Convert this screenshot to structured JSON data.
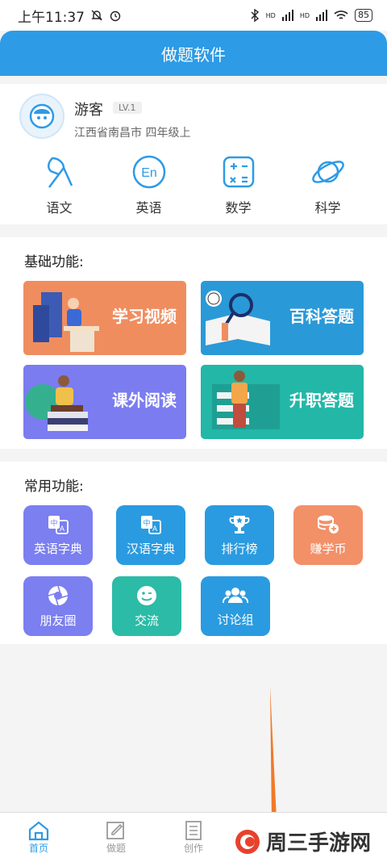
{
  "statusbar": {
    "time": "上午11:37",
    "battery": "85",
    "signal1": "HD",
    "signal2": "HD"
  },
  "header": {
    "title": "做题软件"
  },
  "profile": {
    "name": "游客",
    "level": "LV.1",
    "location": "江西省南昌市 四年级上"
  },
  "subjects": [
    {
      "label": "语文",
      "icon": "pen-tip-icon"
    },
    {
      "label": "英语",
      "icon": "english-en-icon"
    },
    {
      "label": "数学",
      "icon": "calculator-icon"
    },
    {
      "label": "科学",
      "icon": "planet-icon"
    }
  ],
  "basic": {
    "title": "基础功能:",
    "cards": [
      {
        "label": "学习视频",
        "color": "#f08d5f"
      },
      {
        "label": "百科答题",
        "color": "#2a99d8"
      },
      {
        "label": "课外阅读",
        "color": "#7a7cf0"
      },
      {
        "label": "升职答题",
        "color": "#23b7a8"
      }
    ]
  },
  "common": {
    "title": "常用功能:",
    "tools": [
      {
        "label": "英语字典",
        "color": "#7b7ff0",
        "icon": "translate-icon"
      },
      {
        "label": "汉语字典",
        "color": "#2a9be0",
        "icon": "translate-icon"
      },
      {
        "label": "排行榜",
        "color": "#2a9be0",
        "icon": "trophy-icon"
      },
      {
        "label": "赚学币",
        "color": "#f29068",
        "icon": "coins-icon"
      },
      {
        "label": "朋友圈",
        "color": "#7b7ff0",
        "icon": "aperture-icon"
      },
      {
        "label": "交流",
        "color": "#2bbba7",
        "icon": "wink-face-icon"
      },
      {
        "label": "讨论组",
        "color": "#2a9be0",
        "icon": "group-icon"
      }
    ]
  },
  "tabbar": [
    {
      "label": "首页",
      "icon": "home-icon"
    },
    {
      "label": "做题",
      "icon": "edit-icon"
    },
    {
      "label": "创作",
      "icon": "document-icon"
    }
  ],
  "watermark": {
    "text": "周三手游网"
  }
}
